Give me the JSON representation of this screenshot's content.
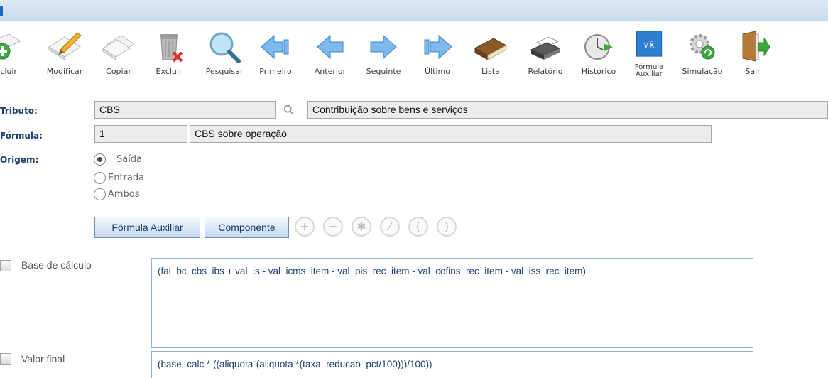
{
  "toolbar": {
    "buttons": [
      {
        "label": "Incluir",
        "icon": "add-icon"
      },
      {
        "label": "Modificar",
        "icon": "edit-icon"
      },
      {
        "label": "Copiar",
        "icon": "copy-icon"
      },
      {
        "label": "Excluir",
        "icon": "trash-icon"
      },
      {
        "label": "Pesquisar",
        "icon": "search-icon"
      },
      {
        "label": "Primeiro",
        "icon": "first-arrow-icon"
      },
      {
        "label": "Anterior",
        "icon": "previous-arrow-icon"
      },
      {
        "label": "Seguinte",
        "icon": "next-arrow-icon"
      },
      {
        "label": "Último",
        "icon": "last-arrow-icon"
      },
      {
        "label": "Lista",
        "icon": "book-icon"
      },
      {
        "label": "Relatório",
        "icon": "printer-icon"
      },
      {
        "label": "Histórico",
        "icon": "history-icon"
      },
      {
        "label": "Fórmula Auxiliar",
        "icon": "sqrt-icon"
      },
      {
        "label": "Simulação",
        "icon": "gears-icon"
      },
      {
        "label": "Sair",
        "icon": "exit-door-icon"
      }
    ]
  },
  "form": {
    "tributo": {
      "label": "Tributo:",
      "code": "CBS",
      "description": "Contribuição sobre bens e serviços"
    },
    "formula": {
      "label": "Fórmula:",
      "code": "1",
      "description": "CBS sobre operação"
    },
    "origem": {
      "label": "Origem:",
      "options": [
        {
          "label": "Saída",
          "selected": true
        },
        {
          "label": "Entrada",
          "selected": false
        },
        {
          "label": "Ambos",
          "selected": false
        }
      ]
    }
  },
  "actions": {
    "formula_auxiliar": "Fórmula Auxiliar",
    "componente": "Componente",
    "operators": [
      "+",
      "−",
      "✱",
      "⁄",
      "(",
      ")"
    ]
  },
  "base_calculo": {
    "label": "Base de cálculo",
    "checked": false,
    "expression": "(fal_bc_cbs_ibs + val_is - val_icms_item - val_pis_rec_item - val_cofins_rec_item - val_iss_rec_item)"
  },
  "valor_final": {
    "label": "Valor final",
    "checked": false,
    "expression": "(base_calc * ((aliquota-(aliquota *(taxa_reducao_pct/100)))/100))"
  },
  "colors": {
    "label_blue": "#1b3f73",
    "accent_blue": "#1a66c9",
    "field_bg": "#ececec"
  }
}
